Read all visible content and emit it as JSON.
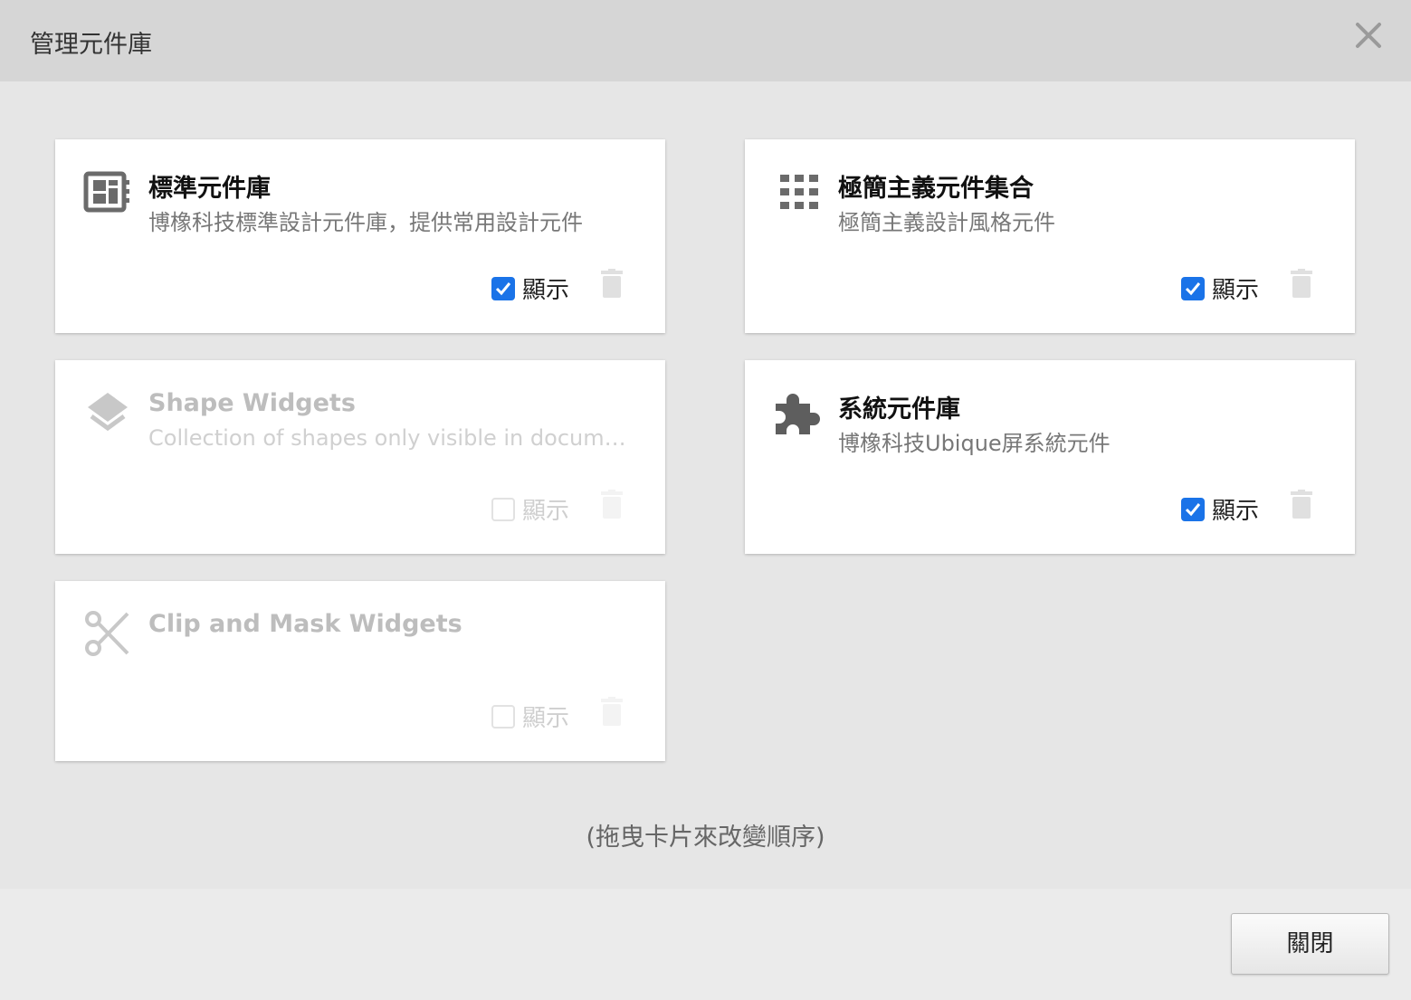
{
  "dialog": {
    "title": "管理元件庫",
    "close_icon": "close-icon",
    "hint": "(拖曳卡片來改變順序)",
    "close_button_label": "關閉"
  },
  "libraries": [
    {
      "title": "標準元件庫",
      "description": "博橡科技標準設計元件庫，提供常用設計元件",
      "icon": "widget-panel-icon",
      "show_label": "顯示",
      "checked": true,
      "enabled": true
    },
    {
      "title": "極簡主義元件集合",
      "description": "極簡主義設計風格元件",
      "icon": "grid-icon",
      "show_label": "顯示",
      "checked": true,
      "enabled": true
    },
    {
      "title": "Shape Widgets",
      "description": "Collection of shapes only visible in documen...",
      "icon": "layers-icon",
      "show_label": "顯示",
      "checked": false,
      "enabled": false
    },
    {
      "title": "系統元件庫",
      "description": "博橡科技Ubique屏系統元件",
      "icon": "puzzle-icon",
      "show_label": "顯示",
      "checked": true,
      "enabled": true
    },
    {
      "title": "Clip and Mask Widgets",
      "description": "",
      "icon": "scissors-icon",
      "show_label": "顯示",
      "checked": false,
      "enabled": false
    }
  ],
  "colors": {
    "accent": "#1a73e8",
    "header_bg": "#d6d6d6",
    "content_bg": "#e6e6e6",
    "card_bg": "#ffffff"
  }
}
